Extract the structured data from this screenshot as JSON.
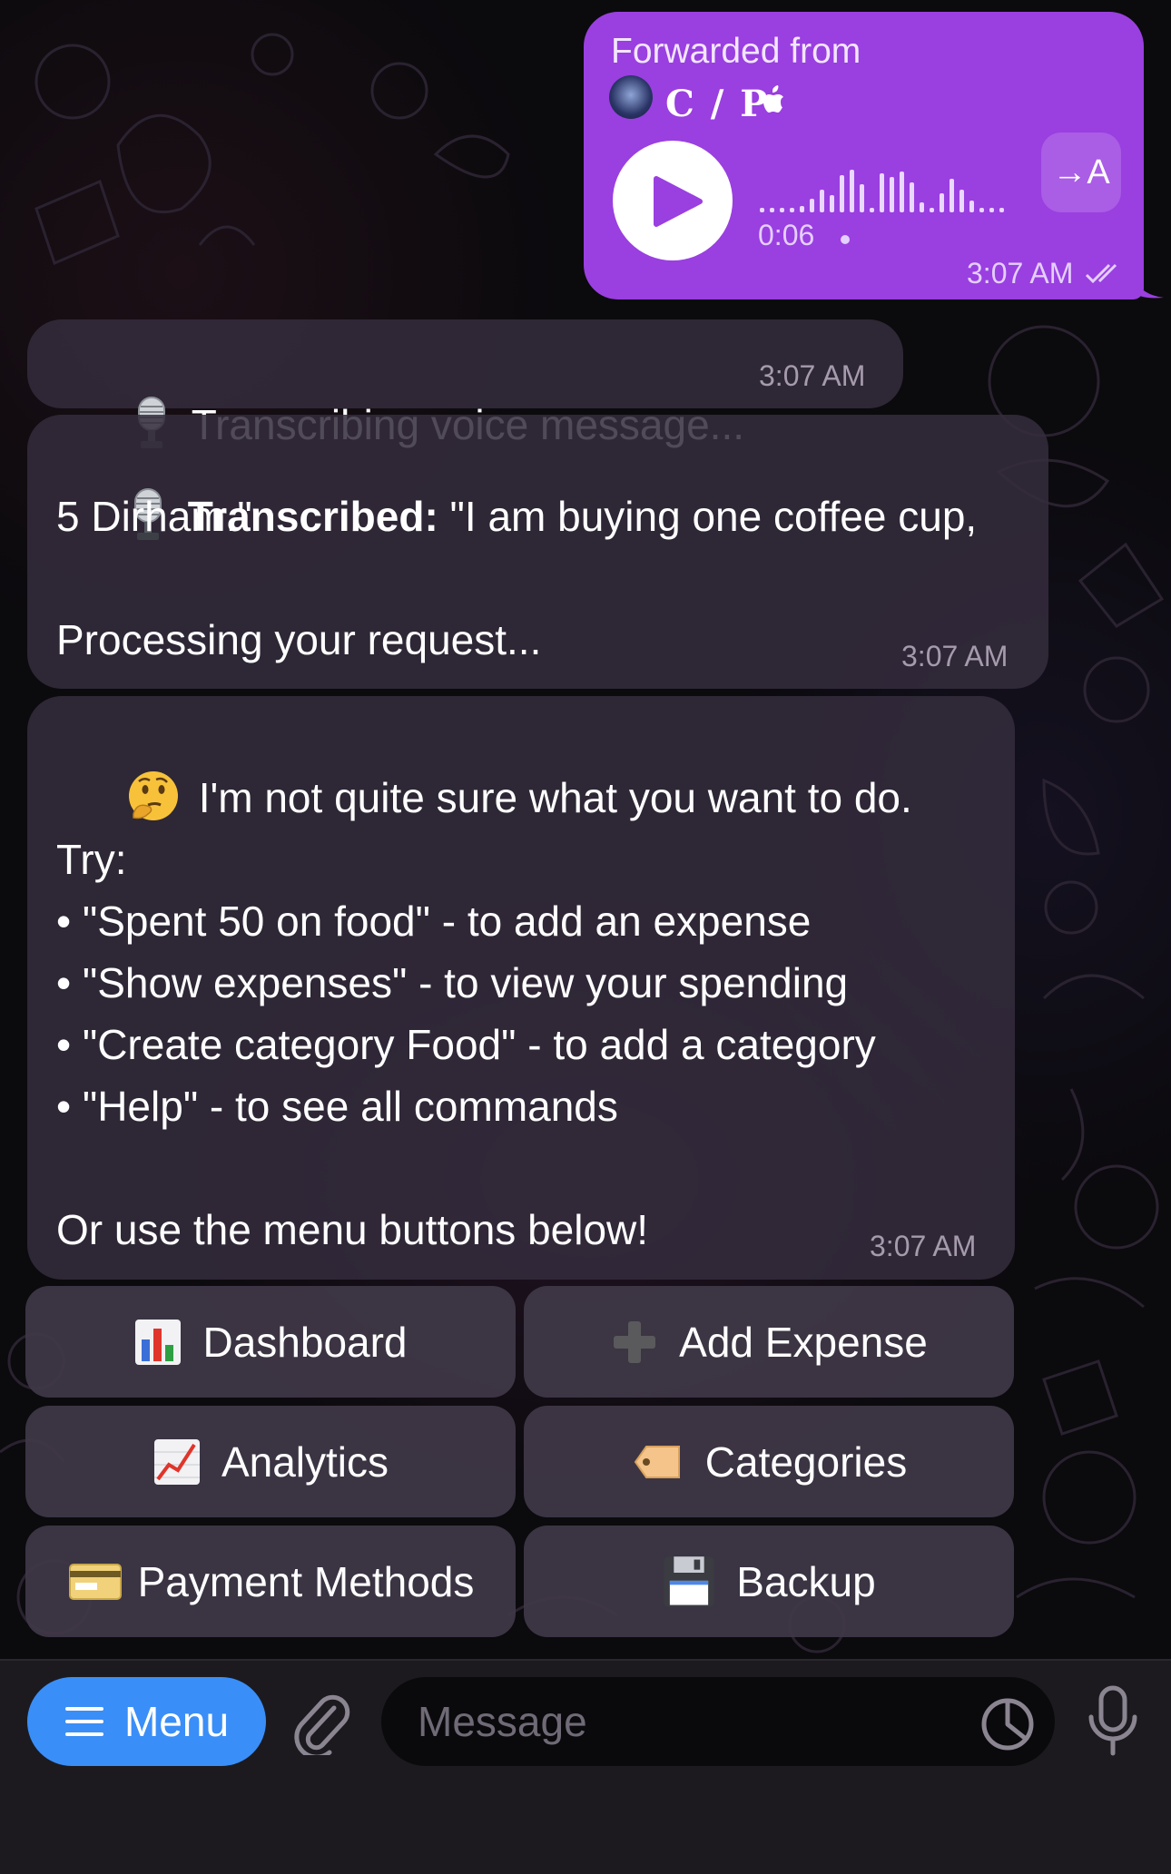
{
  "outgoing_voice": {
    "forwarded_label": "Forwarded from",
    "forwarded_name": "C / P",
    "duration": "0:06",
    "translate_label": "→A",
    "time": "3:07 AM",
    "color": "#9a3fe0"
  },
  "messages": {
    "transcribing": {
      "text": "Transcribing voice message...",
      "time": "3:07 AM"
    },
    "transcribed": {
      "label": "Transcribed:",
      "quote": " \"I am buying one coffee cup,",
      "line2": "5 Dirham.\"",
      "line3": "Processing your request...",
      "time": "3:07 AM"
    },
    "help": {
      "line1": "I'm not quite sure what you want to do.",
      "try": "Try:",
      "tips": [
        "• \"Spent 50 on food\" - to add an expense",
        "• \"Show expenses\" - to view your spending",
        "• \"Create category Food\" - to add a category",
        "• \"Help\" - to see all commands"
      ],
      "footer": "Or use the menu buttons below!",
      "time": "3:07 AM"
    }
  },
  "keyboard": {
    "dashboard": "Dashboard",
    "add_expense": "Add Expense",
    "analytics": "Analytics",
    "categories": "Categories",
    "payment_methods": "Payment Methods",
    "backup": "Backup"
  },
  "composer": {
    "menu_label": "Menu",
    "placeholder": "Message",
    "accent": "#3a8ef7"
  }
}
